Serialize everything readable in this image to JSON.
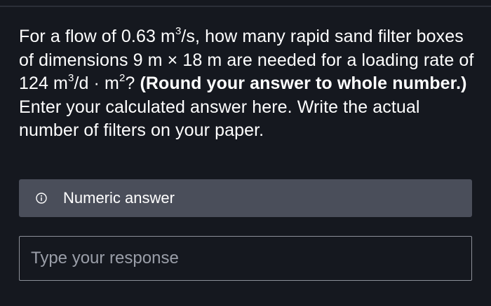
{
  "question": {
    "part1": "For a flow of 0.63 m",
    "sup1": "3",
    "part2": "/s, how many rapid sand filter boxes of dimensions 9 m × 18 m are needed for a loading rate of 124 m",
    "sup2": "3",
    "part3": "/d · m",
    "sup3": "2",
    "part4": "? ",
    "bold": "(Round your answer to whole number.)",
    "part5": " Enter your calculated answer here. Write the actual number of filters on your paper."
  },
  "hint": {
    "icon": "info-icon",
    "label": "Numeric answer"
  },
  "response": {
    "placeholder": "Type your response",
    "value": ""
  },
  "colors": {
    "background": "#15181f",
    "hint_background": "#4a4e5a",
    "input_border": "#8c9099"
  }
}
